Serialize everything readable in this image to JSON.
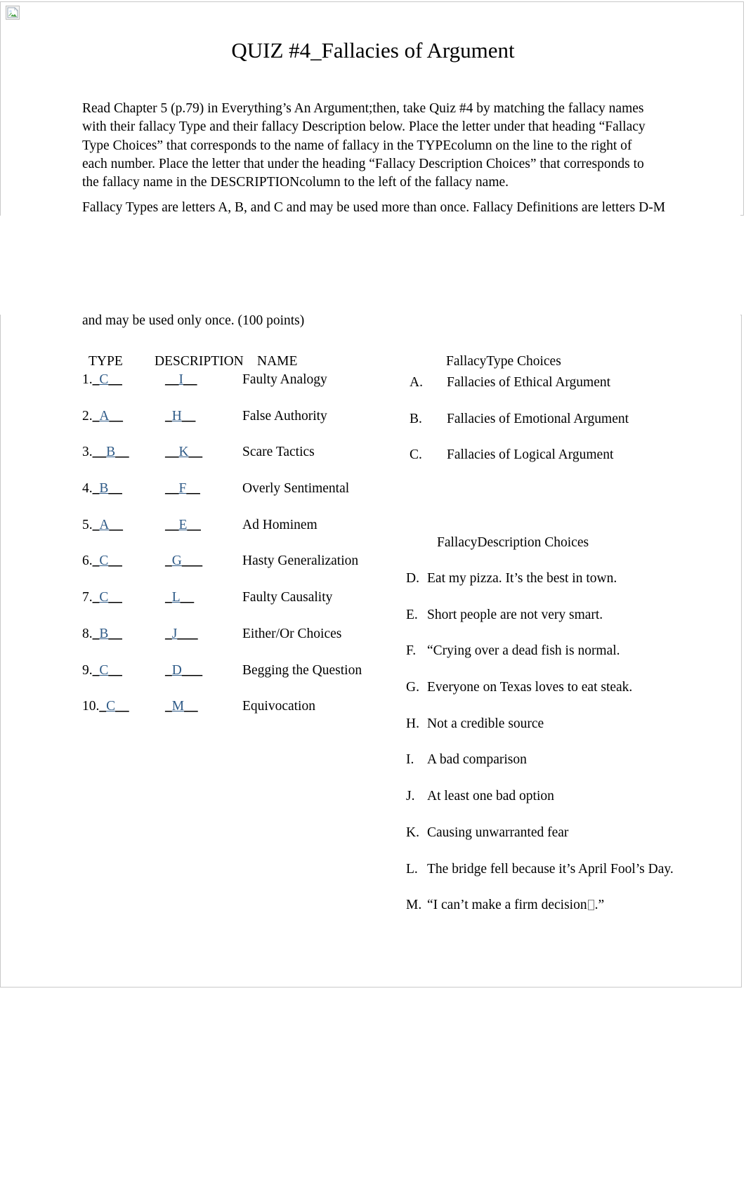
{
  "document": {
    "title": "QUIZ #4_Fallacies of Argument",
    "image_placeholder": "broken-image-icon",
    "answer_color": "#2E5A87",
    "paragraphs": {
      "intro": "Read Chapter 5 (p.79) in Everything’s An Argument;then, take Quiz #4 by matching the fallacy names with their fallacy Type and their fallacy Description below. Place the letter under that heading “Fallacy Type Choices” that corresponds to the name of fallacy in the  TYPEcolumn on the line to the right of each number. Place the letter that under the heading “Fallacy Description Choices” that corresponds to the fallacy name in the DESCRIPTIONcolumn to the left of the fallacy name.",
      "types_note": "Fallacy Types are letters A, B, and C and may be used more than once. Fallacy Definitions are letters D-M",
      "points_note": "and may be used only once.   (100 points)"
    },
    "table": {
      "headers": {
        "type": "TYPE",
        "description": "DESCRIPTION",
        "name": "NAME",
        "type_choices": "FallacyType Choices"
      },
      "rows": [
        {
          "number": "1.",
          "type_blank": "_",
          "type_answer": "C",
          "type_blank_after": "__",
          "desc_blank": "__",
          "desc_answer": "I",
          "desc_blank_after": "__",
          "name": "Faulty Analogy"
        },
        {
          "number": "2.",
          "type_blank": "_",
          "type_answer": "A",
          "type_blank_after": "__",
          "desc_blank": "_",
          "desc_answer": "H",
          "desc_blank_after": "__",
          "name": "False Authority"
        },
        {
          "number": "3.",
          "type_blank": "__",
          "type_answer": "B",
          "type_blank_after": "__",
          "desc_blank": "__",
          "desc_answer": "K",
          "desc_blank_after": "__",
          "name": "Scare Tactics"
        },
        {
          "number": "4.",
          "type_blank": "_",
          "type_answer": "B",
          "type_blank_after": "__",
          "desc_blank": "__",
          "desc_answer": "F",
          "desc_blank_after": "__",
          "name": "Overly Sentimental"
        },
        {
          "number": "5.",
          "type_blank": "_",
          "type_answer": "A",
          "type_blank_after": "__",
          "desc_blank": "__",
          "desc_answer": "E",
          "desc_blank_after": "__",
          "name": "Ad Hominem"
        },
        {
          "number": "6.",
          "type_blank": "_",
          "type_answer": "C",
          "type_blank_after": "__",
          "desc_blank": "_",
          "desc_answer": "G",
          "desc_blank_after": "___",
          "name": "Hasty Generalization"
        },
        {
          "number": "7.",
          "type_blank": "_",
          "type_answer": "C",
          "type_blank_after": "__",
          "desc_blank": "_",
          "desc_answer": "L",
          "desc_blank_after": "__",
          "name": "Faulty Causality"
        },
        {
          "number": "8.",
          "type_blank": "_",
          "type_answer": "B",
          "type_blank_after": "__",
          "desc_blank": "_",
          "desc_answer": "J",
          "desc_blank_after": "___",
          "name": "Either/Or Choices"
        },
        {
          "number": "9.",
          "type_blank": "_",
          "type_answer": "C",
          "type_blank_after": "__",
          "desc_blank": "_",
          "desc_answer": "D",
          "desc_blank_after": "___",
          "name": "Begging the Question"
        },
        {
          "number": "10.",
          "type_blank": "_",
          "type_answer": "C",
          "type_blank_after": "__",
          "desc_blank": "_",
          "desc_answer": "M",
          "desc_blank_after": "__",
          "name": "Equivocation"
        }
      ]
    },
    "type_choices": {
      "heading": "FallacyType Choices",
      "items": [
        {
          "letter": "A.",
          "text": "Fallacies of Ethical Argument"
        },
        {
          "letter": "B.",
          "text": "Fallacies of Emotional Argument"
        },
        {
          "letter": "C.",
          "text": "Fallacies of Logical Argument"
        }
      ]
    },
    "description_choices": {
      "heading": "FallacyDescription Choices",
      "items": [
        {
          "letter": "D.",
          "text": "Eat my pizza. It’s the best in town."
        },
        {
          "letter": "E.",
          "text": "Short people are not very smart."
        },
        {
          "letter": "F.",
          "text": "“Crying over a dead fish is normal."
        },
        {
          "letter": "G.",
          "text": "Everyone on Texas loves to eat steak."
        },
        {
          "letter": "H.",
          "text": "Not a credible source"
        },
        {
          "letter": "I.",
          "text": "A bad comparison"
        },
        {
          "letter": "J.",
          "text": "At least one bad option"
        },
        {
          "letter": "K.",
          "text": "Causing unwarranted fear"
        },
        {
          "letter": "L.",
          "text": "The bridge fell because it’s April Fool’s Day."
        },
        {
          "letter": "M.",
          "text_before": "“I can’t make a firm decision",
          "has_missing_glyph": true,
          "text_after": ".”"
        }
      ]
    }
  }
}
